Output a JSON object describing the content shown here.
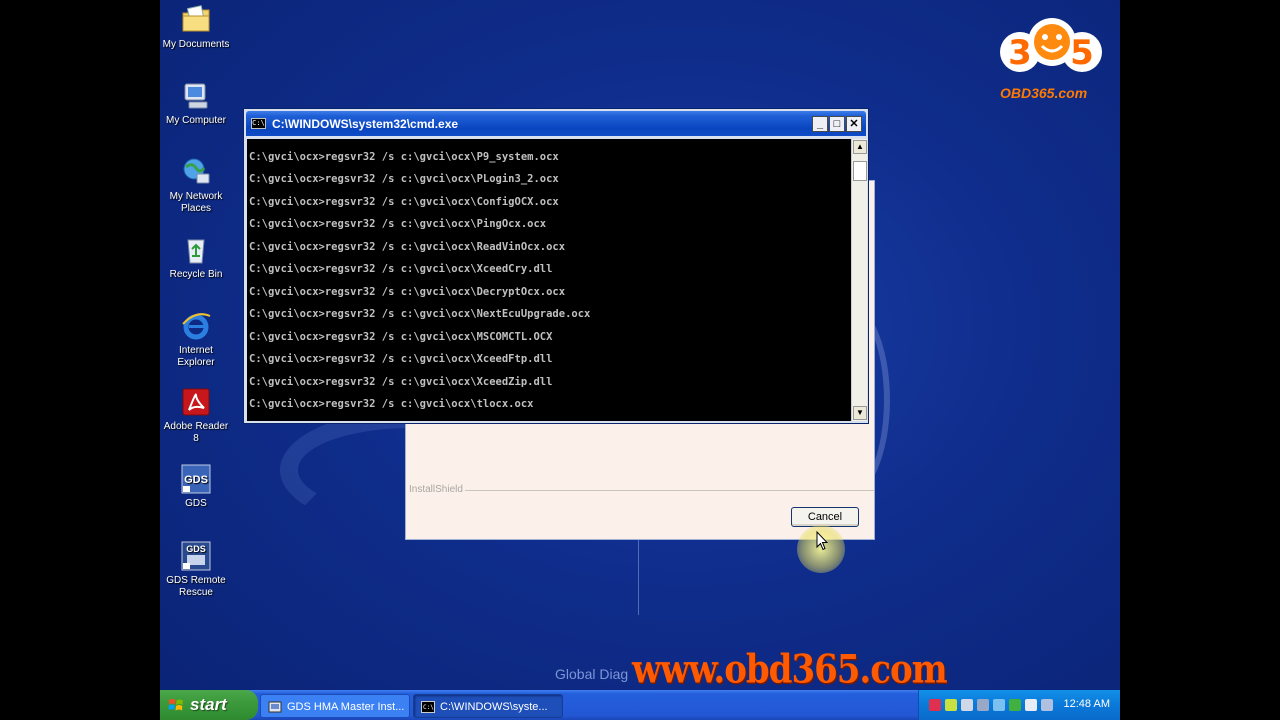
{
  "desktop": {
    "icons": [
      {
        "label": "My Documents",
        "icon": "folder-documents-icon"
      },
      {
        "label": "My Computer",
        "icon": "computer-icon"
      },
      {
        "label": "My Network Places",
        "icon": "network-icon"
      },
      {
        "label": "Recycle Bin",
        "icon": "recycle-bin-icon"
      },
      {
        "label": "Internet Explorer",
        "icon": "ie-icon"
      },
      {
        "label": "Adobe Reader 8",
        "icon": "adobe-reader-icon"
      },
      {
        "label": "GDS",
        "icon": "gds-icon"
      },
      {
        "label": "GDS Remote Rescue",
        "icon": "gds-remote-icon"
      }
    ]
  },
  "watermark": {
    "logo_text": "365",
    "logo_url": "OBD365.com",
    "site": "www.obd365.com",
    "background_text": "Global Diag"
  },
  "cmd_window": {
    "title": "C:\\WINDOWS\\system32\\cmd.exe",
    "icon_text": "C:\\",
    "controls": {
      "minimize": "_",
      "maximize": "□",
      "close": "✕"
    },
    "lines": [
      "C:\\gvci\\ocx>regsvr32 /s c:\\gvci\\ocx\\P9_system.ocx",
      "C:\\gvci\\ocx>regsvr32 /s c:\\gvci\\ocx\\PLogin3_2.ocx",
      "C:\\gvci\\ocx>regsvr32 /s c:\\gvci\\ocx\\ConfigOCX.ocx",
      "C:\\gvci\\ocx>regsvr32 /s c:\\gvci\\ocx\\PingOcx.ocx",
      "C:\\gvci\\ocx>regsvr32 /s c:\\gvci\\ocx\\ReadVinOcx.ocx",
      "C:\\gvci\\ocx>regsvr32 /s c:\\gvci\\ocx\\XceedCry.dll",
      "C:\\gvci\\ocx>regsvr32 /s c:\\gvci\\ocx\\DecryptOcx.ocx",
      "C:\\gvci\\ocx>regsvr32 /s c:\\gvci\\ocx\\NextEcuUpgrade.ocx",
      "C:\\gvci\\ocx>regsvr32 /s c:\\gvci\\ocx\\MSCOMCTL.OCX",
      "C:\\gvci\\ocx>regsvr32 /s c:\\gvci\\ocx\\XceedFtp.dll",
      "C:\\gvci\\ocx>regsvr32 /s c:\\gvci\\ocx\\XceedZip.dll",
      "C:\\gvci\\ocx>regsvr32 /s c:\\gvci\\ocx\\tlocx.ocx"
    ]
  },
  "installer": {
    "section_label": "InstallShield",
    "cancel_label": "Cancel"
  },
  "taskbar": {
    "start_label": "start",
    "tasks": [
      {
        "label": "GDS HMA Master Inst...",
        "active": false
      },
      {
        "label": "C:\\WINDOWS\\syste...",
        "active": true
      }
    ],
    "clock": "12:48 AM"
  }
}
